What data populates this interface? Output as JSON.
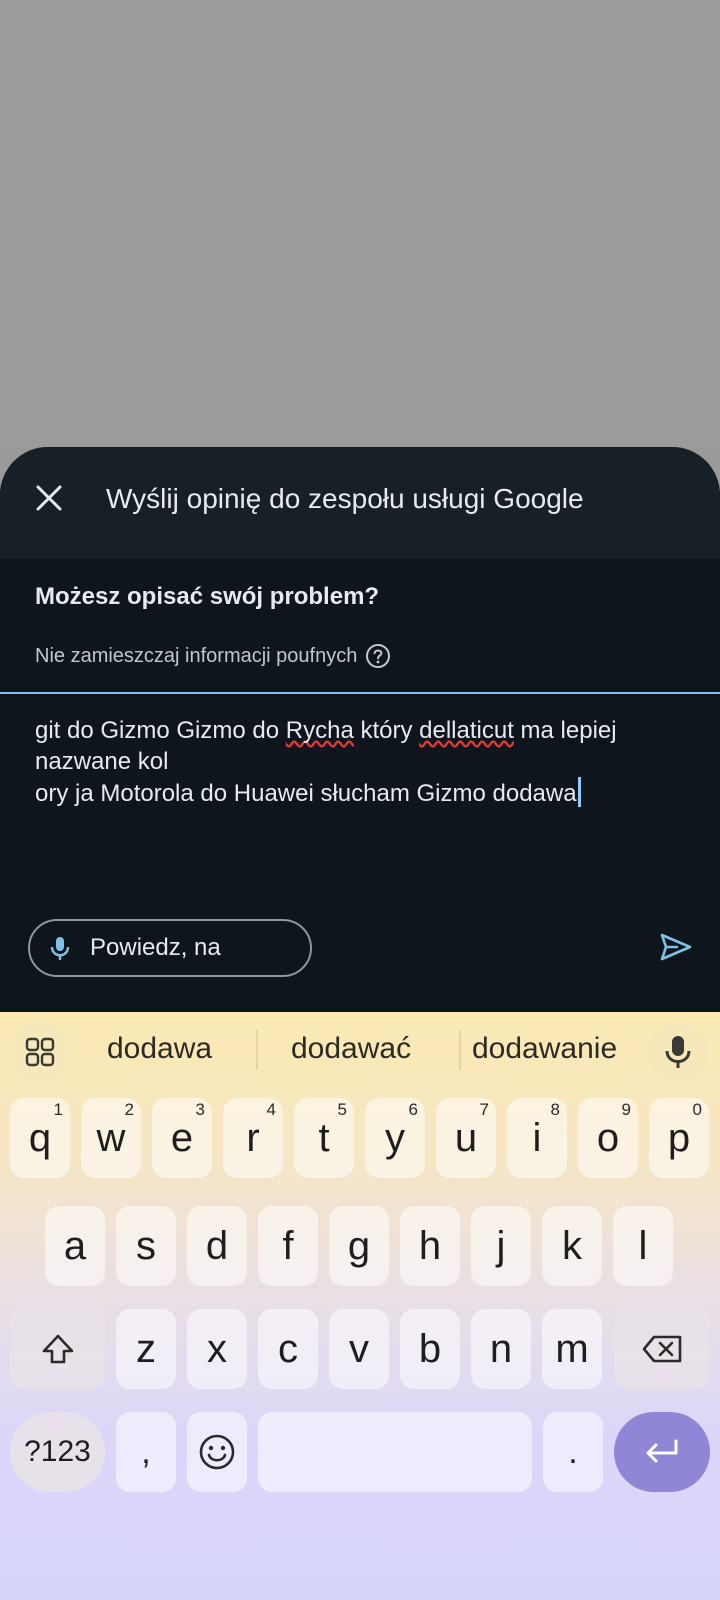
{
  "dialog": {
    "title": "Wyślij opinię do zespołu usługi Google",
    "question": "Możesz opisać swój problem?",
    "hint": "Nie zamieszczaj informacji poufnych",
    "text": {
      "line1_a": "git do Gizmo Gizmo do ",
      "line1_b": "Rycha",
      "line1_c": " który ",
      "line1_d": "dellaticut",
      "line1_e": " ma lepiej",
      "line2": "nazwane kol",
      "line3": "ory ja Motorola do Huawei słucham Gizmo dodawa"
    },
    "voice_label": "Powiedz, na"
  },
  "keyboard": {
    "suggestions": [
      "dodawa",
      "dodawać",
      "dodawanie"
    ],
    "row1": [
      {
        "key": "q",
        "hint": "1"
      },
      {
        "key": "w",
        "hint": "2"
      },
      {
        "key": "e",
        "hint": "3"
      },
      {
        "key": "r",
        "hint": "4"
      },
      {
        "key": "t",
        "hint": "5"
      },
      {
        "key": "y",
        "hint": "6"
      },
      {
        "key": "u",
        "hint": "7"
      },
      {
        "key": "i",
        "hint": "8"
      },
      {
        "key": "o",
        "hint": "9"
      },
      {
        "key": "p",
        "hint": "0"
      }
    ],
    "row2": [
      "a",
      "s",
      "d",
      "f",
      "g",
      "h",
      "j",
      "k",
      "l"
    ],
    "row3": [
      "z",
      "x",
      "c",
      "v",
      "b",
      "n",
      "m"
    ],
    "symbols_label": "?123",
    "comma": ",",
    "period": "."
  },
  "colors": {
    "sheet_bg": "#0f151d",
    "header_bg": "#172027",
    "accent": "#7fc1e8",
    "enter_key": "#8f86d6",
    "spell_error": "#e53935"
  }
}
